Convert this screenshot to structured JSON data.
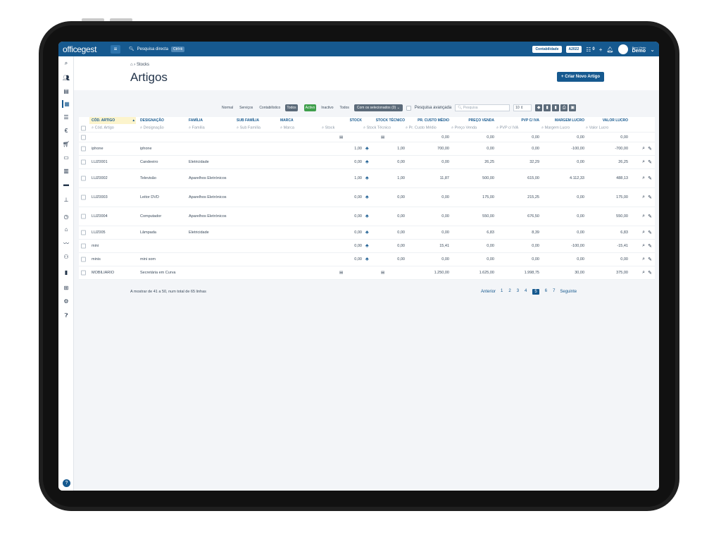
{
  "app": {
    "logo": "officegest"
  },
  "topbar": {
    "search_label": "Pesquisa directa",
    "shortcut": "Ctrl+k",
    "company": "Contabilidade",
    "year": "A2022",
    "counter": "0",
    "welcome": "Bem-Vindo",
    "user": "Demo"
  },
  "header": {
    "breadcrumb": "Stocks",
    "title": "Artigos",
    "create_button": "+ Criar Novo Artigo"
  },
  "toolbar": {
    "type_filters": [
      "Normal",
      "Serviços",
      "Contabilístico",
      "Todos"
    ],
    "type_selected": "Todos",
    "status_filters": [
      "Activo",
      "Inactivo",
      "Todos"
    ],
    "status_selected": "Activo",
    "bulk_action": "Com os selecionados (0)",
    "advanced_search": "Pesquisa avançada",
    "search_placeholder": "Pesquisa",
    "page_size": "10"
  },
  "table": {
    "columns": [
      "CÓD. ARTIGO",
      "DESIGNAÇÃO",
      "FAMÍLIA",
      "SUB FAMÍLIA",
      "MARCA",
      "STOCK",
      "STOCK TÉCNICO",
      "PR. CUSTO MÉDIO",
      "PREÇO VENDA",
      "PVP C/ IVA",
      "MARGEM LUCRO",
      "VALOR LUCRO"
    ],
    "filters": [
      "Cód. Artigo",
      "Designação",
      "Família",
      "Sub Família",
      "Marca",
      "Stock",
      "Stock Técnico",
      "Pr. Custo Médio",
      "Preço Venda",
      "PVP c/ IVA",
      "Margem Lucro",
      "Valor Lucro"
    ],
    "summary": {
      "pr_custo": "0,00",
      "preco": "0,00",
      "pvp": "0,00",
      "margem": "0,00",
      "valor": "0,00"
    },
    "rows": [
      {
        "cod": "iphone",
        "des": "iphone",
        "fam": "",
        "stock": "1,00",
        "tecnico": "1,00",
        "custo": "700,00",
        "preco": "0,00",
        "pvp": "0,00",
        "margem": "-100,00",
        "valor": "-700,00"
      },
      {
        "cod": "LUZ0001",
        "des": "Candeeiro",
        "fam": "Eletricidade",
        "stock": "0,00",
        "tecnico": "0,00",
        "custo": "0,00",
        "preco": "26,25",
        "pvp": "32,29",
        "margem": "0,00",
        "valor": "26,25"
      },
      {
        "cod": "LUZ0002",
        "des": "Televisão",
        "fam": "Aparelhos Eletrónicos",
        "stock": "1,00",
        "tecnico": "1,00",
        "custo": "11,87",
        "preco": "500,00",
        "pvp": "615,00",
        "margem": "4.112,33",
        "valor": "488,13"
      },
      {
        "cod": "LUZ0003",
        "des": "Leitor DVD",
        "fam": "Aparelhos Eletrónicos",
        "stock": "0,00",
        "tecnico": "0,00",
        "custo": "0,00",
        "preco": "175,00",
        "pvp": "215,25",
        "margem": "0,00",
        "valor": "175,00"
      },
      {
        "cod": "LUZ0004",
        "des": "Computador",
        "fam": "Aparelhos Eletrónicos",
        "stock": "0,00",
        "tecnico": "0,00",
        "custo": "0,00",
        "preco": "550,00",
        "pvp": "676,50",
        "margem": "0,00",
        "valor": "550,00"
      },
      {
        "cod": "LUZ005",
        "des": "Lâmpada",
        "fam": "Eletricidade",
        "stock": "0,00",
        "tecnico": "0,00",
        "custo": "0,00",
        "preco": "6,83",
        "pvp": "8,39",
        "margem": "0,00",
        "valor": "6,83"
      },
      {
        "cod": "mini",
        "des": "",
        "fam": "",
        "stock": "0,00",
        "tecnico": "0,00",
        "custo": "15,41",
        "preco": "0,00",
        "pvp": "0,00",
        "margem": "-100,00",
        "valor": "-15,41"
      },
      {
        "cod": "minis",
        "des": "mini som",
        "fam": "",
        "stock": "0,00",
        "tecnico": "0,00",
        "custo": "0,00",
        "preco": "0,00",
        "pvp": "0,00",
        "margem": "0,00",
        "valor": "0,00"
      },
      {
        "cod": "MOBILIARIO",
        "des": "Secretária em Curva",
        "fam": "",
        "stock": "",
        "tecnico": "",
        "custo": "1.250,00",
        "preco": "1.625,00",
        "pvp": "1.998,75",
        "margem": "30,00",
        "valor": "375,00"
      }
    ]
  },
  "footer": {
    "info": "A mostrar de 41 a 50, num total de 65 linhas",
    "prev": "Anterior",
    "pages": [
      "1",
      "2",
      "3",
      "4",
      "5",
      "6",
      "7"
    ],
    "current": "5",
    "next": "Seguinte"
  },
  "colors": {
    "brand": "#16598f",
    "active_green": "#3f9f4c"
  }
}
